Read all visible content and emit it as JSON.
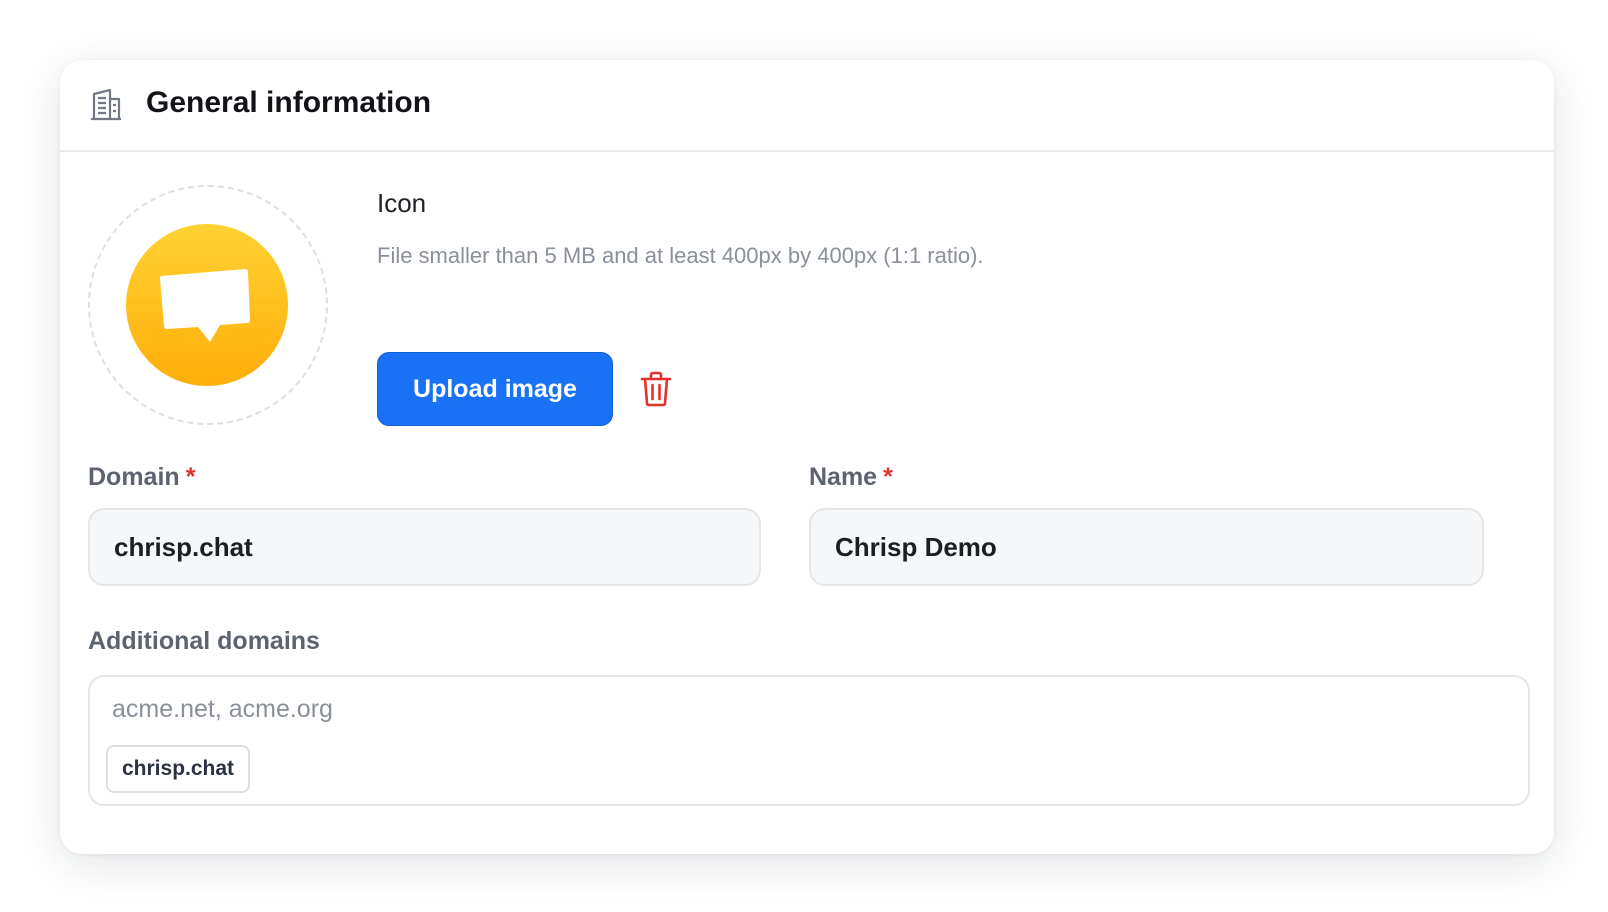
{
  "section": {
    "title": "General information",
    "icon": "building-icon"
  },
  "icon_upload": {
    "label": "Icon",
    "hint": "File smaller than 5 MB and at least 400px by 400px (1:1 ratio).",
    "upload_button": "Upload image",
    "avatar_icon": "chat-bubble-icon",
    "delete_icon": "trash-icon"
  },
  "domain": {
    "label": "Domain",
    "required_mark": "*",
    "value": "chrisp.chat"
  },
  "name": {
    "label": "Name",
    "required_mark": "*",
    "value": "Chrisp Demo"
  },
  "additional_domains": {
    "label": "Additional domains",
    "placeholder": "acme.net, acme.org",
    "tags": [
      "chrisp.chat"
    ]
  },
  "colors": {
    "accent": "#1972f5",
    "danger": "#e5312b",
    "avatar_top": "#ffd233",
    "avatar_bottom": "#ffae0a"
  }
}
